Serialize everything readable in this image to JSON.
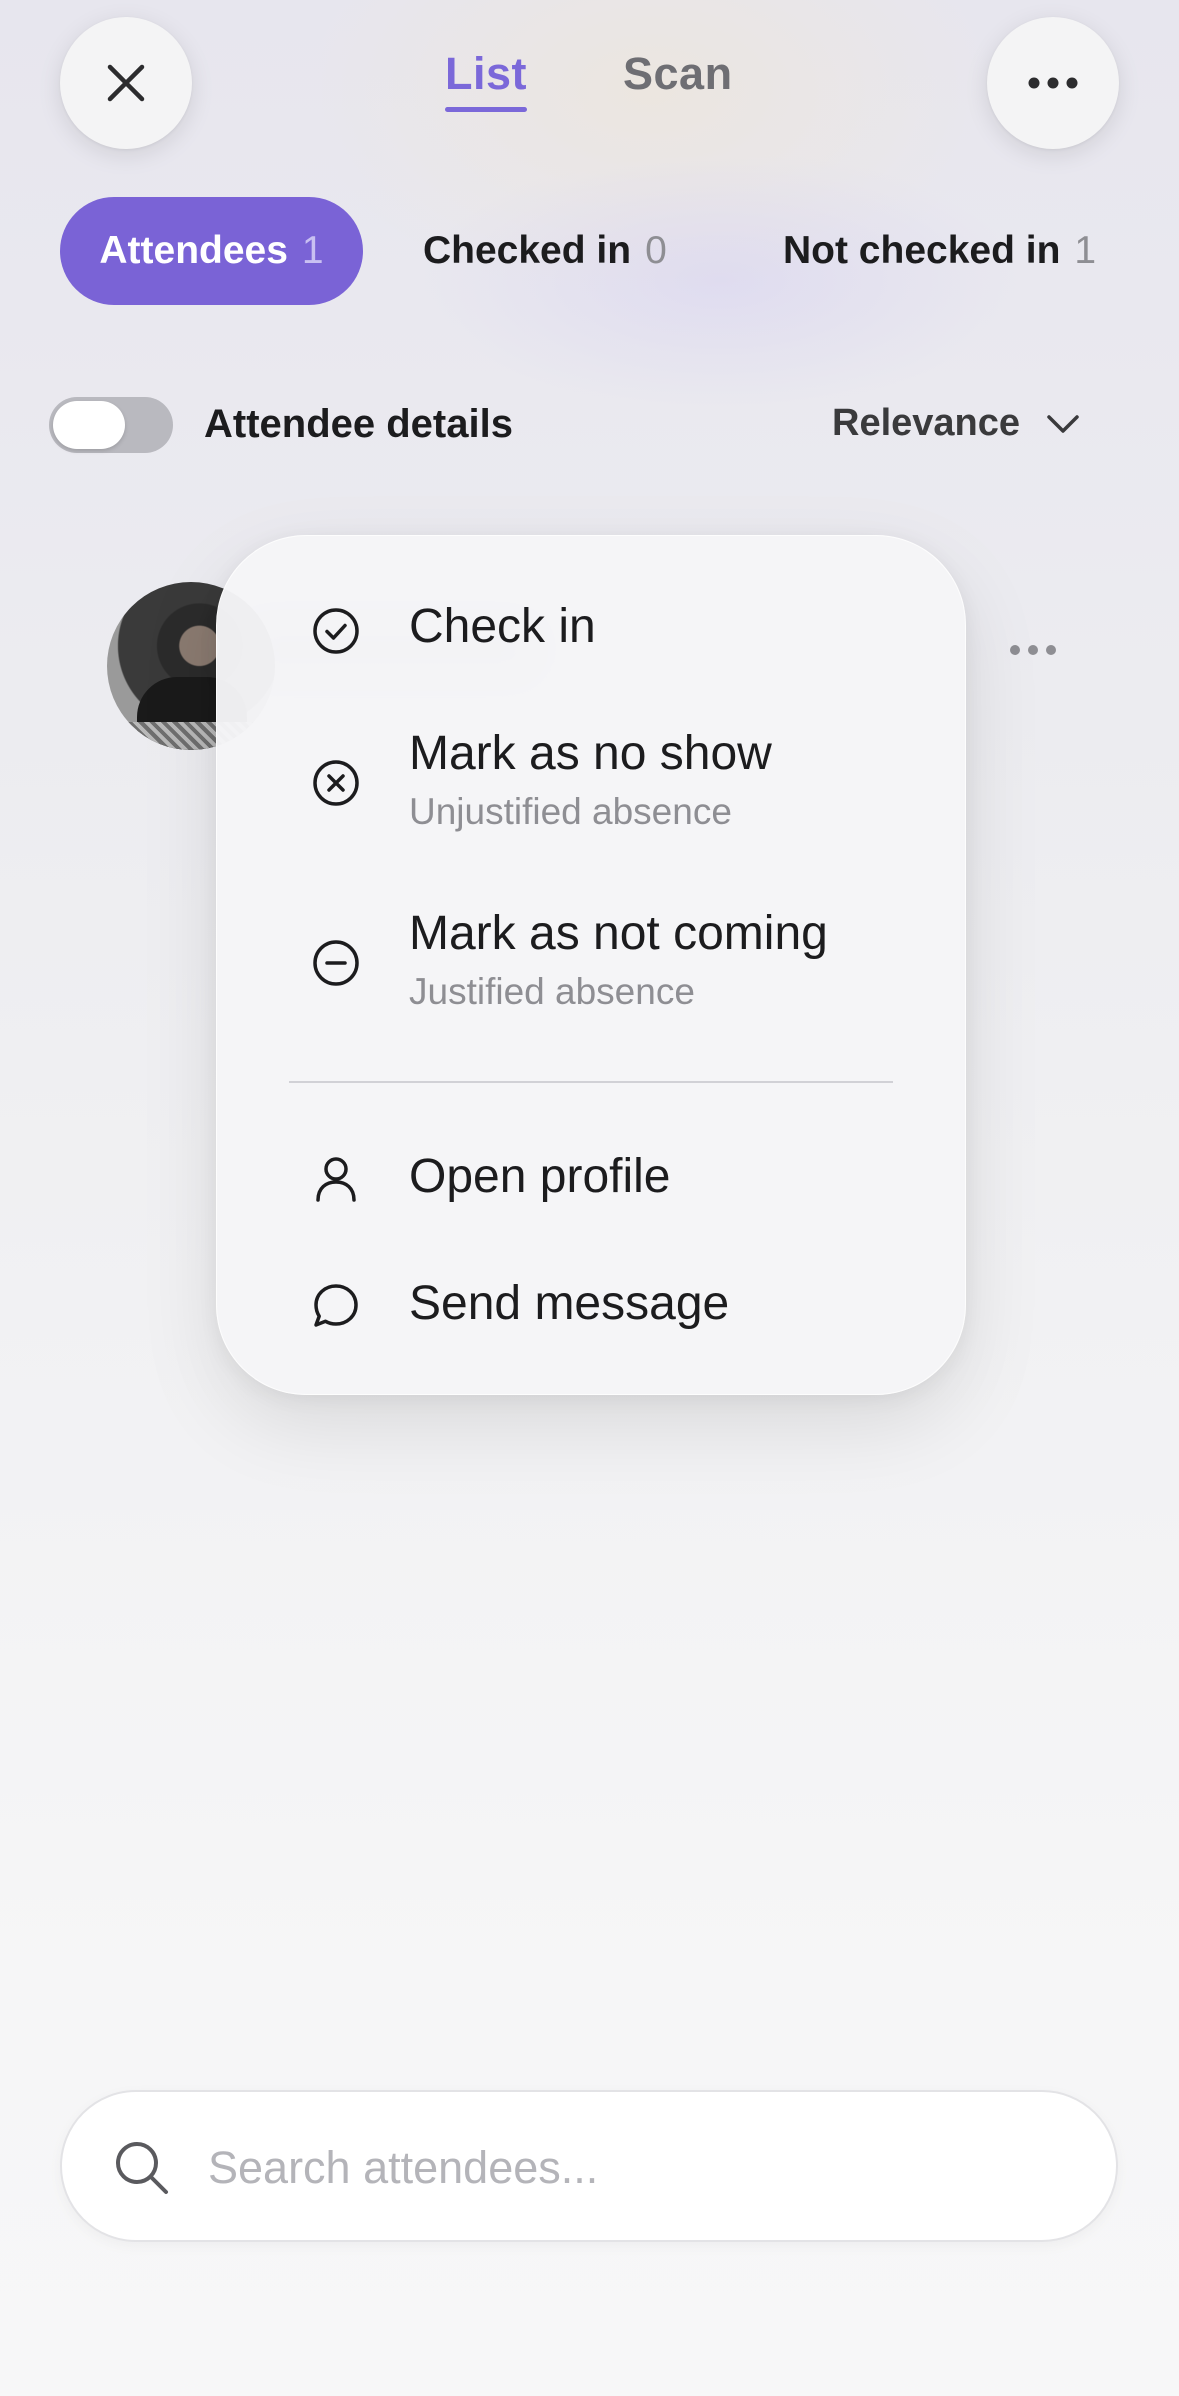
{
  "header": {
    "tabs": [
      {
        "label": "List",
        "active": true
      },
      {
        "label": "Scan",
        "active": false
      }
    ],
    "close_icon": "close-icon",
    "more_icon": "more-horizontal-icon"
  },
  "filters": [
    {
      "label": "Attendees",
      "count": "1",
      "active": true
    },
    {
      "label": "Checked in",
      "count": "0",
      "active": false
    },
    {
      "label": "Not checked in",
      "count": "1",
      "active": false
    }
  ],
  "controls": {
    "toggle_label": "Attendee details",
    "toggle_on": false,
    "sort_label": "Relevance"
  },
  "context_menu": {
    "items": [
      {
        "label": "Check in",
        "icon": "check-circle-icon"
      },
      {
        "label": "Mark as no show",
        "sub": "Unjustified absence",
        "icon": "x-circle-icon"
      },
      {
        "label": "Mark as not coming",
        "sub": "Justified absence",
        "icon": "minus-circle-icon"
      },
      {
        "label": "Open profile",
        "icon": "user-icon"
      },
      {
        "label": "Send message",
        "icon": "message-icon"
      }
    ]
  },
  "search": {
    "placeholder": "Search attendees...",
    "value": ""
  },
  "colors": {
    "accent": "#7a63d6",
    "tab_active": "#7b68d9"
  }
}
